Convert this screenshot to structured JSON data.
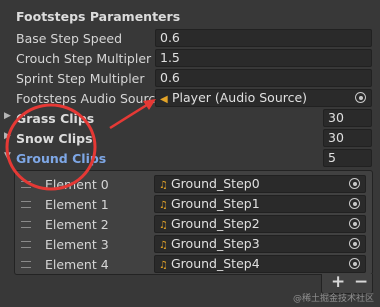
{
  "header": {
    "title": "Footsteps Paramenters"
  },
  "fields": [
    {
      "label": "Base Step Speed",
      "value": "0.6"
    },
    {
      "label": "Crouch Step Multipler",
      "value": "1.5"
    },
    {
      "label": "Sprint Step Multipler",
      "value": "0.6"
    }
  ],
  "audio_source": {
    "label": "Footsteps Audio Source",
    "value": "Player (Audio Source)",
    "icon": "speaker-icon"
  },
  "foldouts": [
    {
      "label": "Grass Clips",
      "size": "30",
      "expanded": false
    },
    {
      "label": "Snow Clips",
      "size": "30",
      "expanded": false
    },
    {
      "label": "Ground Clips",
      "size": "5",
      "expanded": true
    }
  ],
  "ground_list": [
    {
      "label": "Element 0",
      "value": "Ground_Step0"
    },
    {
      "label": "Element 1",
      "value": "Ground_Step1"
    },
    {
      "label": "Element 2",
      "value": "Ground_Step2"
    },
    {
      "label": "Element 3",
      "value": "Ground_Step3"
    },
    {
      "label": "Element 4",
      "value": "Ground_Step4"
    }
  ],
  "list_footer": {
    "add": "+",
    "remove": "−"
  },
  "watermark": "@稀土掘金技术社区",
  "colors": {
    "annotation": "#e53935",
    "active_label": "#7ea7e6",
    "audio_icon": "#e4a428"
  }
}
